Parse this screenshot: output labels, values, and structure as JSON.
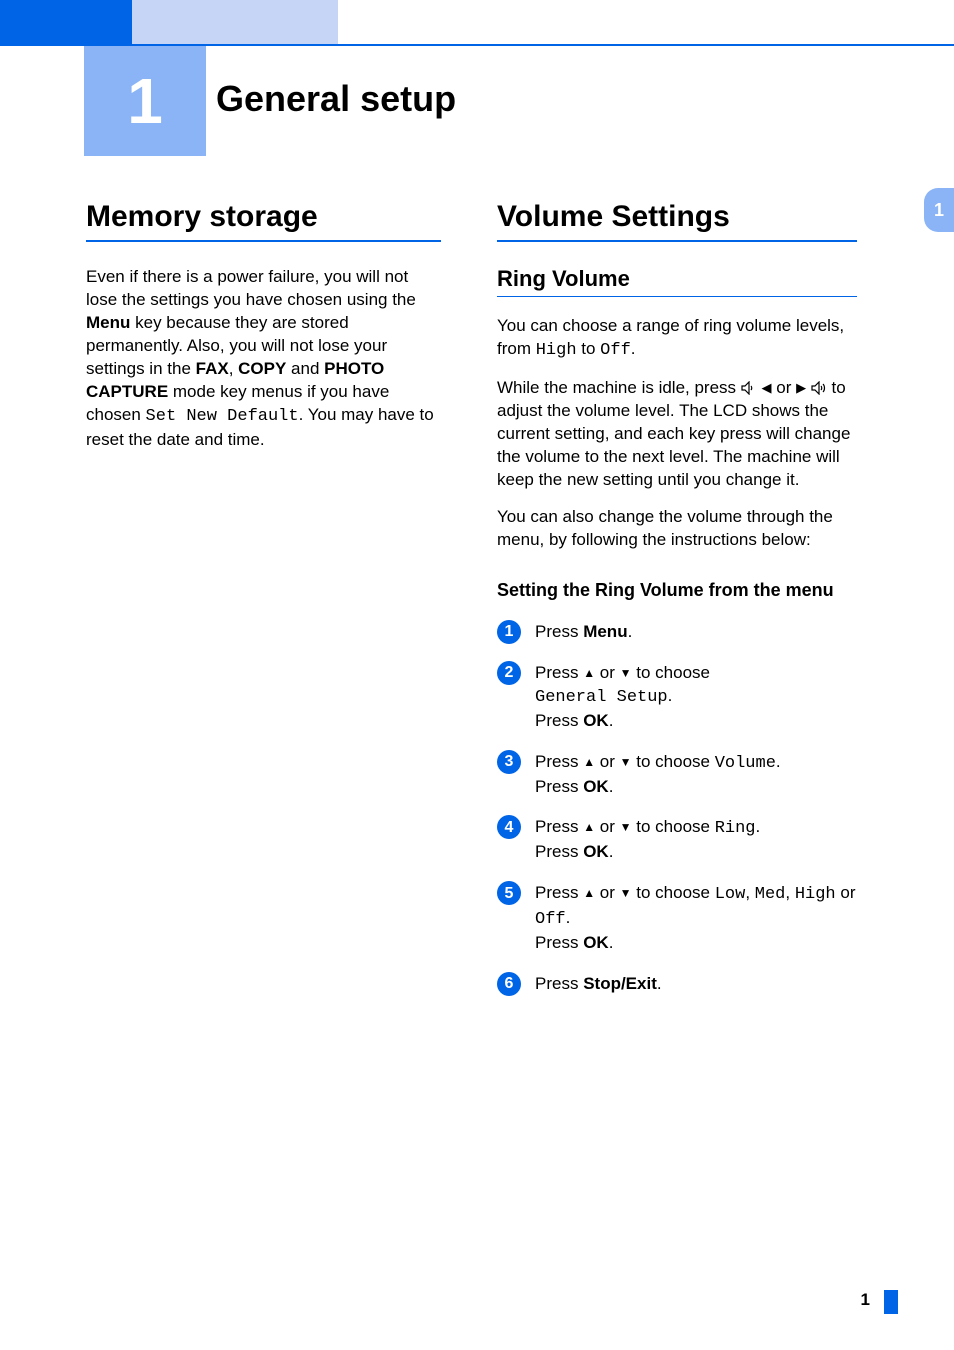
{
  "chapter": {
    "number": "1",
    "title": "General setup"
  },
  "side_tab": "1",
  "page_number": "1",
  "left": {
    "heading": "Memory storage",
    "p1_a": "Even if there is a power failure, you will not lose the settings you have chosen using the ",
    "p1_menu": "Menu",
    "p1_b": " key because they are stored permanently. Also, you will not lose your settings in the ",
    "p1_fax": "FAX",
    "p1_comma1": ", ",
    "p1_copy": "COPY",
    "p1_and": " and ",
    "p1_photo": "PHOTO CAPTURE",
    "p1_c": " mode key menus if you have chosen ",
    "p1_mono": "Set New Default",
    "p1_d": ". You may have to reset the date and time."
  },
  "right": {
    "heading": "Volume Settings",
    "sub": "Ring Volume",
    "p1_a": "You can choose a range of ring volume levels, from ",
    "p1_high": "High",
    "p1_to": " to ",
    "p1_off": "Off",
    "p1_end": ".",
    "p2_a": "While the machine is idle, press ",
    "p2_or": " or ",
    "p2_b": " to adjust the volume level. The LCD shows the current setting, and each key press will change the volume to the next level. The machine will keep the new setting until you change it.",
    "p3": "You can also change the volume through the menu, by following the instructions below:",
    "subsub": "Setting the Ring Volume from the menu",
    "steps": {
      "s1": {
        "press": "Press ",
        "menu": "Menu",
        "end": "."
      },
      "s2": {
        "press": "Press ",
        "to_choose": " to choose ",
        "mono": "General Setup",
        "dot": ".",
        "press_ok": "Press ",
        "ok": "OK",
        "dot2": "."
      },
      "s3": {
        "press": "Press ",
        "to_choose": " to choose ",
        "mono": "Volume",
        "dot": ".",
        "press_ok": "Press ",
        "ok": "OK",
        "dot2": "."
      },
      "s4": {
        "press": "Press ",
        "to_choose": " to choose ",
        "mono": "Ring",
        "dot": ".",
        "press_ok": "Press ",
        "ok": "OK",
        "dot2": "."
      },
      "s5": {
        "press": "Press ",
        "to_choose": " to choose ",
        "m1": "Low",
        "c1": ", ",
        "m2": "Med",
        "c2": ", ",
        "m3": "High",
        "or": " or ",
        "m4": "Off",
        "dot": ".",
        "press_ok": "Press ",
        "ok": "OK",
        "dot2": "."
      },
      "s6": {
        "press": "Press ",
        "stop": "Stop/Exit",
        "end": "."
      }
    }
  }
}
